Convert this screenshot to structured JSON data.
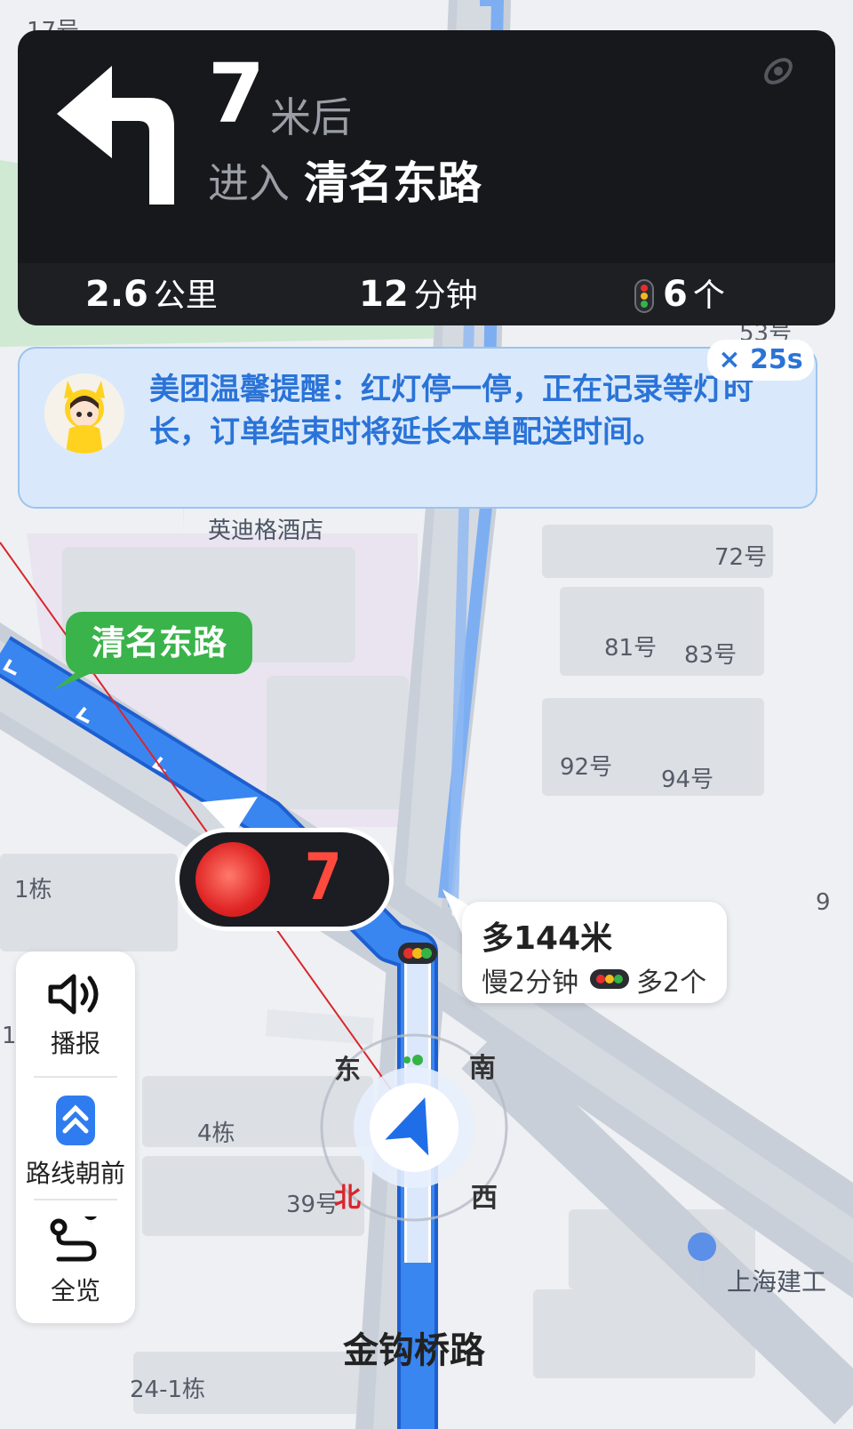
{
  "colors": {
    "route_blue": "#3a86f0",
    "nav_bg": "#17181b",
    "tip_text": "#2a73d8",
    "tag_green": "#3ab34a",
    "light_red": "#e02424"
  },
  "nav": {
    "distance": "7",
    "distance_unit": "米后",
    "enter_label": "进入",
    "next_road": "清名东路",
    "turn_icon": "turn-left-arrow-icon",
    "remaining_distance": "2.6",
    "remaining_distance_unit": "公里",
    "remaining_time": "12",
    "remaining_time_unit": "分钟",
    "lights_count": "6",
    "lights_unit": "个"
  },
  "reminder": {
    "text": "美团温馨提醒：红灯停一停，正在记录等灯时长，订单结束时将延长本单配送时间。",
    "close_label": "× 25s"
  },
  "map": {
    "road_tag": "清名东路",
    "bottom_road": "金钩桥路",
    "poi_hotel": "英迪格酒店",
    "poi_bottom_right": "上海建工",
    "labels": {
      "n53": "53号",
      "n72": "72号",
      "n81": "81号",
      "n83": "83号",
      "n92": "92号",
      "n94": "94号",
      "b1": "1栋",
      "b4": "4栋",
      "n39": "39号",
      "b24": "24-1栋",
      "top_cut": "17号",
      "right_9": "9",
      "left_cut": "1"
    },
    "compass": {
      "east": "东",
      "south": "南",
      "north": "北",
      "west": "西"
    }
  },
  "traffic_light": {
    "countdown": "7",
    "state": "red"
  },
  "info_bubble": {
    "extra_distance": "多144米",
    "slower": "慢2分钟",
    "extra_lights": "多2个"
  },
  "side_panel": {
    "voice": "播报",
    "heading_up": "路线朝前",
    "overview": "全览"
  }
}
